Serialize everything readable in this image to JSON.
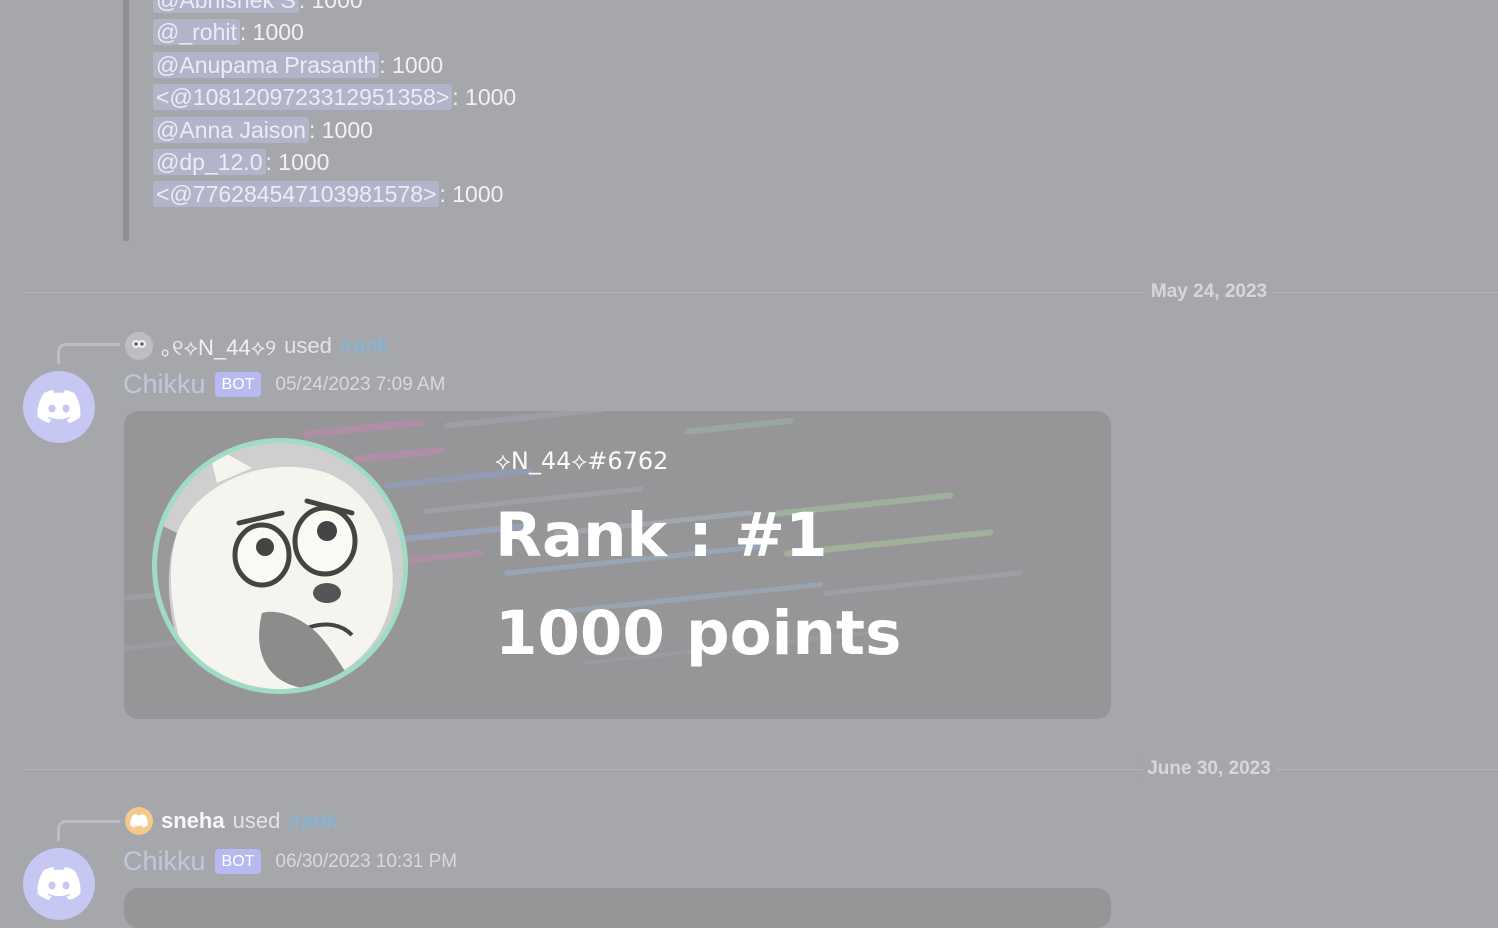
{
  "leaderboard": {
    "rows": [
      {
        "user": "@Abhishek S",
        "sep": ": ",
        "points": "1000"
      },
      {
        "user": "@_rohit",
        "sep": ": ",
        "points": "1000"
      },
      {
        "user": "@Anupama Prasanth",
        "sep": ": ",
        "points": "1000"
      },
      {
        "user": "<@1081209723312951358>",
        "sep": ": ",
        "points": "1000"
      },
      {
        "user": "@Anna Jaison",
        "sep": ": ",
        "points": "1000"
      },
      {
        "user": "@dp_12.0",
        "sep": ": ",
        "points": "1000"
      },
      {
        "user": "<@776284547103981578>",
        "sep": ": ",
        "points": "1000"
      }
    ]
  },
  "dividers": {
    "first": "May 24, 2023",
    "second": "June 30, 2023"
  },
  "messages": [
    {
      "reply_user": "｡୧⟡N_44⟡୨",
      "reply_used": "used",
      "reply_command": "/rank",
      "bot_name": "Chikku",
      "bot_tag": "BOT",
      "timestamp": "05/24/2023 7:09 AM",
      "card": {
        "username": "⟡N_44⟡#6762",
        "rank_line": "Rank : #1",
        "points_line": "1000 points"
      }
    },
    {
      "reply_user": "sneha",
      "reply_used": "used",
      "reply_command": "/rank",
      "bot_name": "Chikku",
      "bot_tag": "BOT",
      "timestamp": "06/30/2023 10:31 PM"
    }
  ],
  "colors": {
    "background": "#a6a7aa",
    "mention_bg": "#b3b3c9",
    "command_link": "#7fb7dd",
    "bot_tag": "#b8b9f0",
    "avatar": "#c6c7f3",
    "pfp_ring": "#9fdcc3"
  },
  "icons": {
    "bot_avatar": "discord-logo-icon",
    "n44_avatar": "user-avatar-icon",
    "sneha_avatar": "discord-logo-icon"
  }
}
